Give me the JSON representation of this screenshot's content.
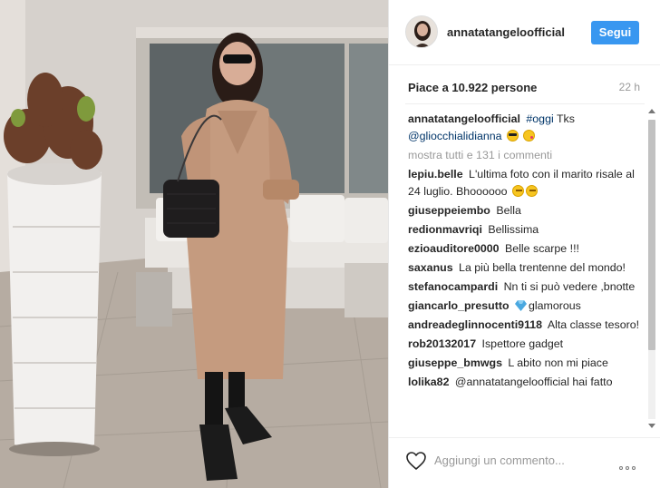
{
  "post": {
    "username": "annatatangeloofficial",
    "follow_label": "Segui",
    "likes": "Piace a 10.922 persone",
    "time": "22 h",
    "caption": {
      "user": "annatatangeloofficial",
      "hashtag": "#oggi",
      "text": "Tks",
      "mention": "@gliocchialidianna",
      "emojis": [
        "sunglasses-face",
        "kiss-face"
      ]
    },
    "view_all": "mostra tutti e 131 i commenti",
    "comments": [
      {
        "user": "lepiu.belle",
        "text": "L'ultima foto con il marito risale al 24 luglio. Bhoooooo",
        "emojis": [
          "thinking-face",
          "thinking-face"
        ]
      },
      {
        "user": "giuseppeiembo",
        "text": "Bella"
      },
      {
        "user": "redionmavriqi",
        "text": "Bellissima"
      },
      {
        "user": "ezioauditore0000",
        "text": "Belle scarpe !!!"
      },
      {
        "user": "saxanus",
        "text": "La più bella trentenne del mondo!"
      },
      {
        "user": "stefanocampardi",
        "text": "Nn ti si può vedere ,bnotte"
      },
      {
        "user": "giancarlo_presutto",
        "text": "glamorous",
        "emojis": [
          "gem"
        ]
      },
      {
        "user": "andreadeglinnocenti9118",
        "text": "Alta classe tesoro!"
      },
      {
        "user": "rob20132017",
        "text": "Ispettore gadget"
      },
      {
        "user": "giuseppe_bmwgs",
        "text": "L abito non mi piace"
      },
      {
        "user": "lolika82",
        "text": "@annatatangeloofficial hai fatto"
      }
    ],
    "comment_placeholder": "Aggiungi un commento...",
    "icons": {
      "like": "heart-icon",
      "more": "more-options-icon"
    },
    "colors": {
      "accent": "#3897f0",
      "link": "#003569",
      "muted": "#999999"
    }
  }
}
